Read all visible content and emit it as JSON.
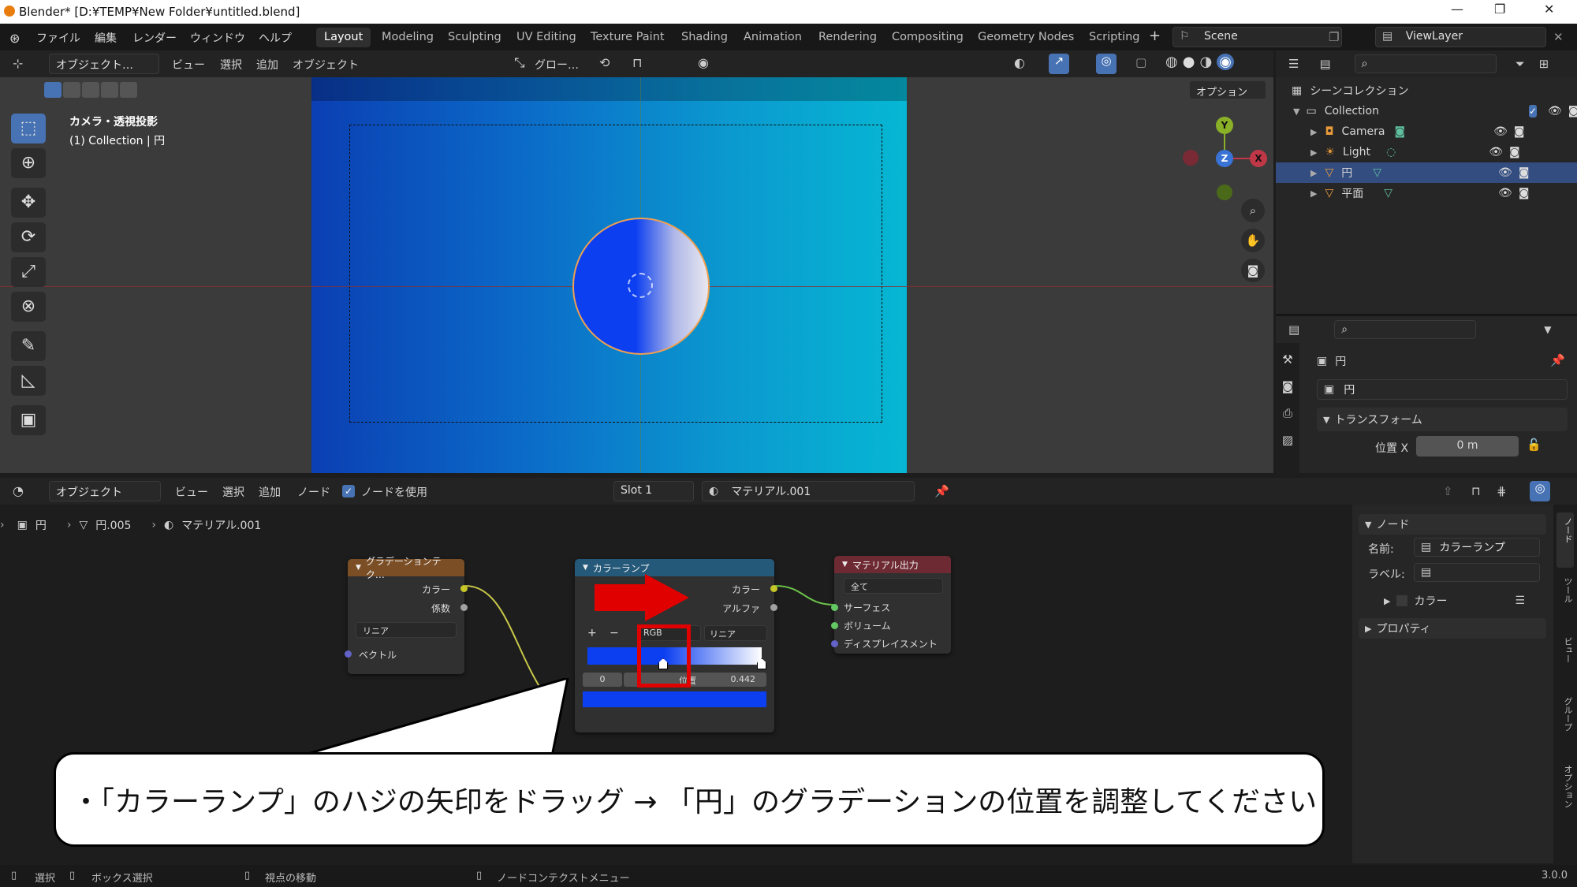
{
  "window": {
    "title": "Blender* [D:¥TEMP¥New Folder¥untitled.blend]",
    "minimize": "—",
    "maximize": "❐",
    "close": "✕"
  },
  "menubar": {
    "items": [
      "ファイル",
      "編集",
      "レンダー",
      "ウィンドウ",
      "ヘルプ"
    ]
  },
  "workspaces": {
    "active": "Layout",
    "tabs": [
      "Layout",
      "Modeling",
      "Sculpting",
      "UV Editing",
      "Texture Paint",
      "Shading",
      "Animation",
      "Rendering",
      "Compositing",
      "Geometry Nodes",
      "Scripting"
    ],
    "add": "+"
  },
  "scene": {
    "name": "Scene",
    "view_layer": "ViewLayer"
  },
  "viewport_header": {
    "mode": "オブジェクト…",
    "menus": [
      "ビュー",
      "選択",
      "追加",
      "オブジェクト"
    ],
    "transform": "グロー…",
    "options": "オプション"
  },
  "viewport": {
    "camera_label": "カメラ・透視投影",
    "collection_label": "(1) Collection | 円",
    "gizmo": {
      "y": "Y",
      "z": "Z",
      "x": "X"
    }
  },
  "outliner": {
    "title": "シーンコレクション",
    "rows": [
      {
        "label": "Collection",
        "type": "collection"
      },
      {
        "label": "Camera",
        "type": "camera"
      },
      {
        "label": "Light",
        "type": "light"
      },
      {
        "label": "円",
        "type": "mesh",
        "selected": true
      },
      {
        "label": "平面",
        "type": "mesh"
      }
    ]
  },
  "properties": {
    "object_name": "円",
    "data_name": "円",
    "panel": "トランスフォーム",
    "field_label": "位置 X",
    "field_value": "0 m"
  },
  "node_header": {
    "mode": "オブジェクト",
    "menus": [
      "ビュー",
      "選択",
      "追加",
      "ノード"
    ],
    "use_nodes": "ノードを使用",
    "slot": "Slot 1",
    "material": "マテリアル.001"
  },
  "breadcrumb": {
    "object": "円",
    "mesh": "円.005",
    "material": "マテリアル.001"
  },
  "nodes": {
    "gradient": {
      "title": "グラデーションテク…",
      "out_color": "カラー",
      "out_fac": "係数",
      "type": "リニア",
      "in_vector": "ベクトル"
    },
    "colorramp": {
      "title": "カラーランプ",
      "out_color": "カラー",
      "out_alpha": "アルファ",
      "add": "+",
      "remove": "−",
      "mode": "RGB",
      "interp": "リニア",
      "index": "0",
      "pos_label": "位置",
      "pos_value": "0.442",
      "colors": {
        "left": "#0c3ff0",
        "right": "#ffffff",
        "swatch": "#0b3ff0"
      }
    },
    "output": {
      "title": "マテリアル出力",
      "target": "全て",
      "in_surface": "サーフェス",
      "in_volume": "ボリューム",
      "in_disp": "ディスプレイスメント"
    }
  },
  "sidepanel": {
    "node_panel": "ノード",
    "name_label": "名前:",
    "name_value": "カラーランプ",
    "label_label": "ラベル:",
    "color_panel": "カラー",
    "props_panel": "プロパティ",
    "tabs": [
      "ノード",
      "ツール",
      "ビュー",
      "グループ",
      "オプション"
    ]
  },
  "statusbar": {
    "select": "選択",
    "box_select": "ボックス選択",
    "rotate_view": "視点の移動",
    "context_menu": "ノードコンテクストメニュー",
    "version": "3.0.0"
  },
  "instruction": "・「カラーランプ」のハジの矢印をドラッグ → 「円」のグラデーションの位置を調整してください"
}
